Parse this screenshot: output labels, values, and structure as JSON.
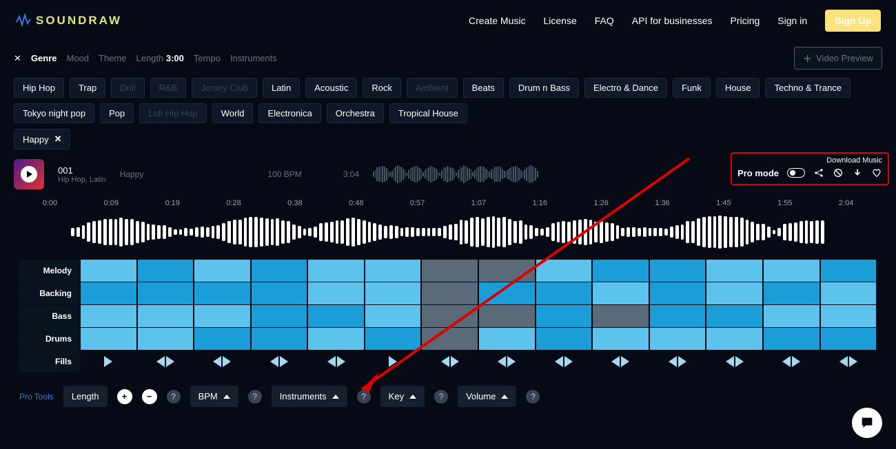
{
  "brand": "SOUNDRAW",
  "nav": {
    "create": "Create Music",
    "license": "License",
    "faq": "FAQ",
    "api": "API for businesses",
    "pricing": "Pricing",
    "signin": "Sign in",
    "signup": "Sign Up"
  },
  "filters": {
    "genre": "Genre",
    "mood": "Mood",
    "theme": "Theme",
    "length": "Length",
    "length_val": "3:00",
    "tempo": "Tempo",
    "instruments": "Instruments",
    "video_preview": "Video Preview"
  },
  "genres": [
    {
      "t": "Hip Hop",
      "d": false
    },
    {
      "t": "Trap",
      "d": false
    },
    {
      "t": "Drill",
      "d": true
    },
    {
      "t": "R&B",
      "d": true
    },
    {
      "t": "Jersey Club",
      "d": true
    },
    {
      "t": "Latin",
      "d": false
    },
    {
      "t": "Acoustic",
      "d": false
    },
    {
      "t": "Rock",
      "d": false
    },
    {
      "t": "Ambient",
      "d": true
    },
    {
      "t": "Beats",
      "d": false
    },
    {
      "t": "Drum n Bass",
      "d": false
    },
    {
      "t": "Electro & Dance",
      "d": false
    },
    {
      "t": "Funk",
      "d": false
    },
    {
      "t": "House",
      "d": false
    },
    {
      "t": "Techno & Trance",
      "d": false
    },
    {
      "t": "Tokyo night pop",
      "d": false
    },
    {
      "t": "Pop",
      "d": false
    },
    {
      "t": "Lofi Hip Hop",
      "d": true
    },
    {
      "t": "World",
      "d": false
    },
    {
      "t": "Electronica",
      "d": false
    },
    {
      "t": "Orchestra",
      "d": false
    },
    {
      "t": "Tropical House",
      "d": false
    }
  ],
  "mood_tag": "Happy",
  "track": {
    "num": "001",
    "genres": "Hip Hop, Latin",
    "mood": "Happy",
    "bpm": "100 BPM",
    "dur": "3:04"
  },
  "download": {
    "label": "Download Music",
    "pro": "Pro mode"
  },
  "ticks": [
    "0:00",
    "0:09",
    "0:19",
    "0:28",
    "0:38",
    "0:48",
    "0:57",
    "1:07",
    "1:16",
    "1:26",
    "1:36",
    "1:45",
    "1:55",
    "2:04"
  ],
  "rows": {
    "melody": "Melody",
    "backing": "Backing",
    "bass": "Bass",
    "drums": "Drums",
    "fills": "Fills"
  },
  "seg": {
    "melody": [
      "c2",
      "c1",
      "c2",
      "c1",
      "c2",
      "c2",
      "c3",
      "c3",
      "c2",
      "c1",
      "c1",
      "c2",
      "c2",
      "c1"
    ],
    "backing": [
      "c1",
      "c1",
      "c1",
      "c1",
      "c2",
      "c2",
      "c3",
      "c1",
      "c1",
      "c2",
      "c1",
      "c2",
      "c1",
      "c2"
    ],
    "bass": [
      "c2",
      "c2",
      "c2",
      "c1",
      "c1",
      "c2",
      "c3",
      "c3",
      "c1",
      "c3",
      "c1",
      "c1",
      "c2",
      "c2"
    ],
    "drums": [
      "c2",
      "c2",
      "c1",
      "c1",
      "c2",
      "c1",
      "c3",
      "c2",
      "c1",
      "c2",
      "c2",
      "c2",
      "c1",
      "c1"
    ]
  },
  "fills": [
    {
      "l": false,
      "r": true
    },
    {
      "l": true,
      "r": true
    },
    {
      "l": true,
      "r": true
    },
    {
      "l": true,
      "r": true
    },
    {
      "l": true,
      "r": true
    },
    {
      "l": false,
      "r": true
    },
    {
      "l": true,
      "r": true
    },
    {
      "l": true,
      "r": true
    },
    {
      "l": true,
      "r": true
    },
    {
      "l": true,
      "r": true
    },
    {
      "l": true,
      "r": true
    },
    {
      "l": true,
      "r": true
    },
    {
      "l": true,
      "r": true
    },
    {
      "l": true,
      "r": true
    }
  ],
  "protools": {
    "label": "Pro Tools",
    "length": "Length",
    "bpm": "BPM",
    "instruments": "Instruments",
    "key": "Key",
    "volume": "Volume"
  }
}
